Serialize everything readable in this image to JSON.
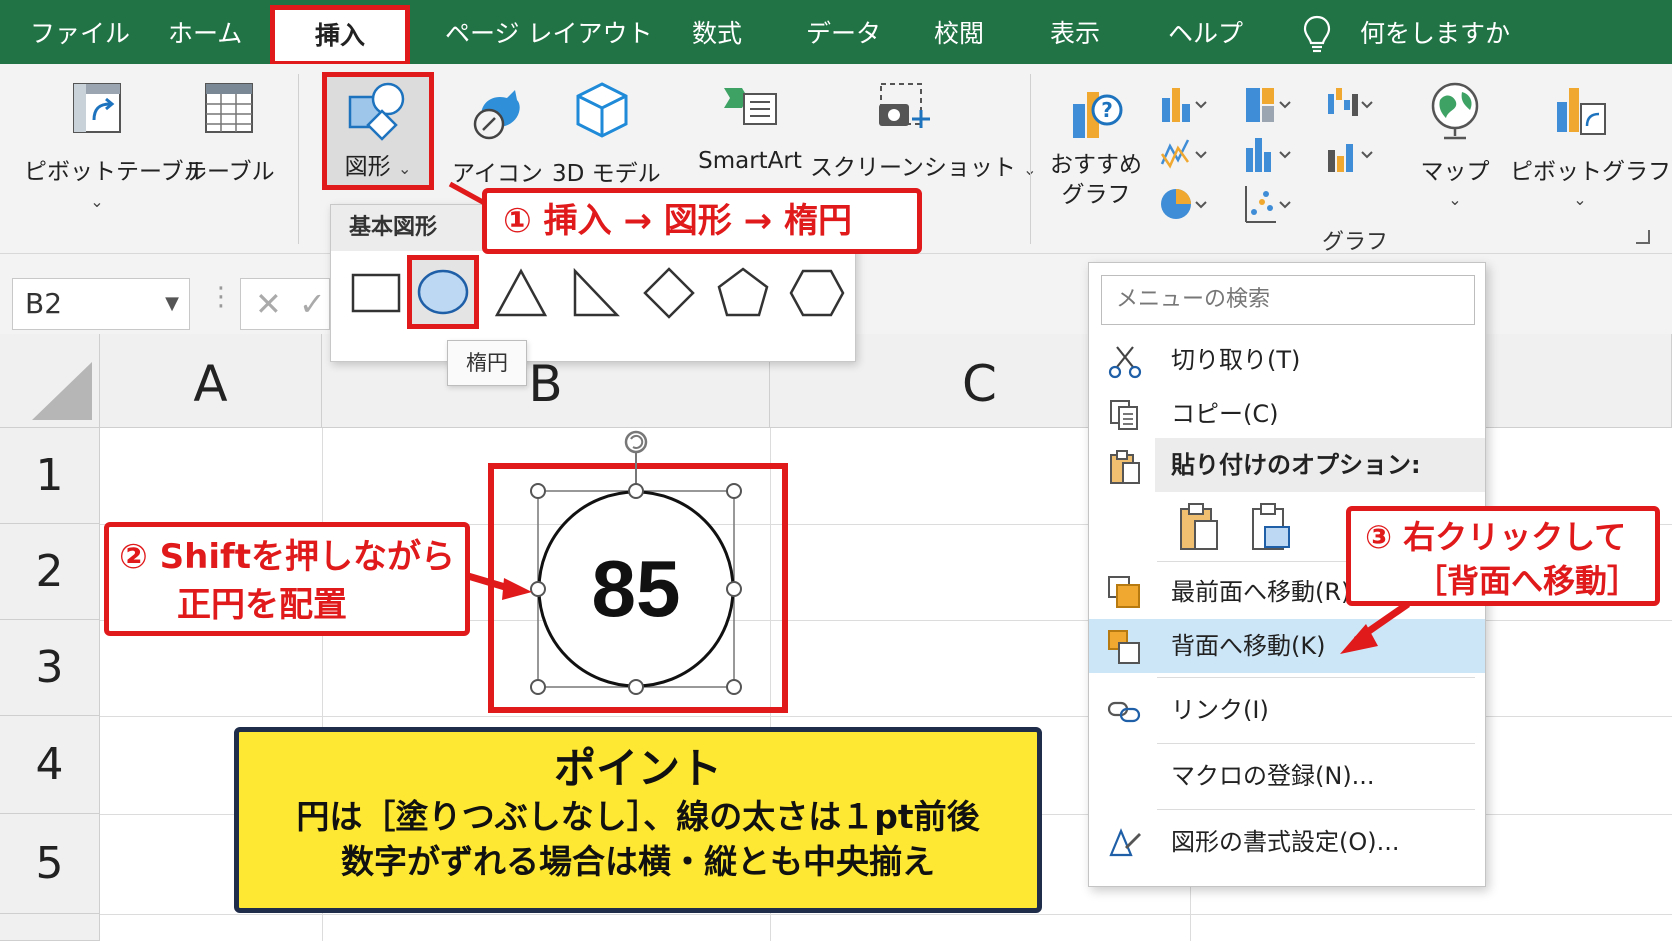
{
  "tabs": [
    {
      "label": "ファイル"
    },
    {
      "label": "ホーム"
    },
    {
      "label": "挿入"
    },
    {
      "label": "ページ レイアウト"
    },
    {
      "label": "数式"
    },
    {
      "label": "データ"
    },
    {
      "label": "校閲"
    },
    {
      "label": "表示"
    },
    {
      "label": "ヘルプ"
    }
  ],
  "tell_me": "何をしますか",
  "ribbon": {
    "pivot_table": "ピボットテーブル",
    "table": "テーブル",
    "shapes": "図形",
    "icons": "アイコン",
    "models_3d": "3D モデル",
    "smartart": "SmartArt",
    "screenshot": "スクリーンショット",
    "recommended_charts": [
      "おすすめ",
      "グラフ"
    ],
    "maps": "マップ",
    "pivot_chart": "ピボットグラフ",
    "charts_group": "グラフ"
  },
  "name_box": "B2",
  "columns": [
    "A",
    "B",
    "C"
  ],
  "rows": [
    "1",
    "2",
    "3",
    "4",
    "5"
  ],
  "shapes_dropdown": {
    "header": "基本図形",
    "tooltip": "楕円"
  },
  "circle_value": "85",
  "context_menu": {
    "search_placeholder": "メニューの検索",
    "cut": "切り取り(T)",
    "copy": "コピー(C)",
    "paste_options": "貼り付けのオプション:",
    "bring_to_front": "最前面へ移動(R)",
    "send_to_back": "背面へ移動(K)",
    "link": "リンク(I)",
    "assign_macro": "マクロの登録(N)...",
    "format_shape": "図形の書式設定(O)..."
  },
  "annotations": {
    "step1": "① 挿入 → 図形 → 楕円",
    "step2": [
      "② Shiftを押しながら",
      "正円を配置"
    ],
    "step3": [
      "③ 右クリックして",
      "［背面へ移動］"
    ]
  },
  "point": {
    "title": "ポイント",
    "line1": "円は［塗りつぶしなし］、線の太さは１pt前後",
    "line2": "数字がずれる場合は横・縦とも中央揃え"
  },
  "colors": {
    "excel_green": "#217346",
    "annotation_red": "#e0191b",
    "point_yellow": "#ffe833",
    "menu_highlight": "#cde6f7"
  }
}
